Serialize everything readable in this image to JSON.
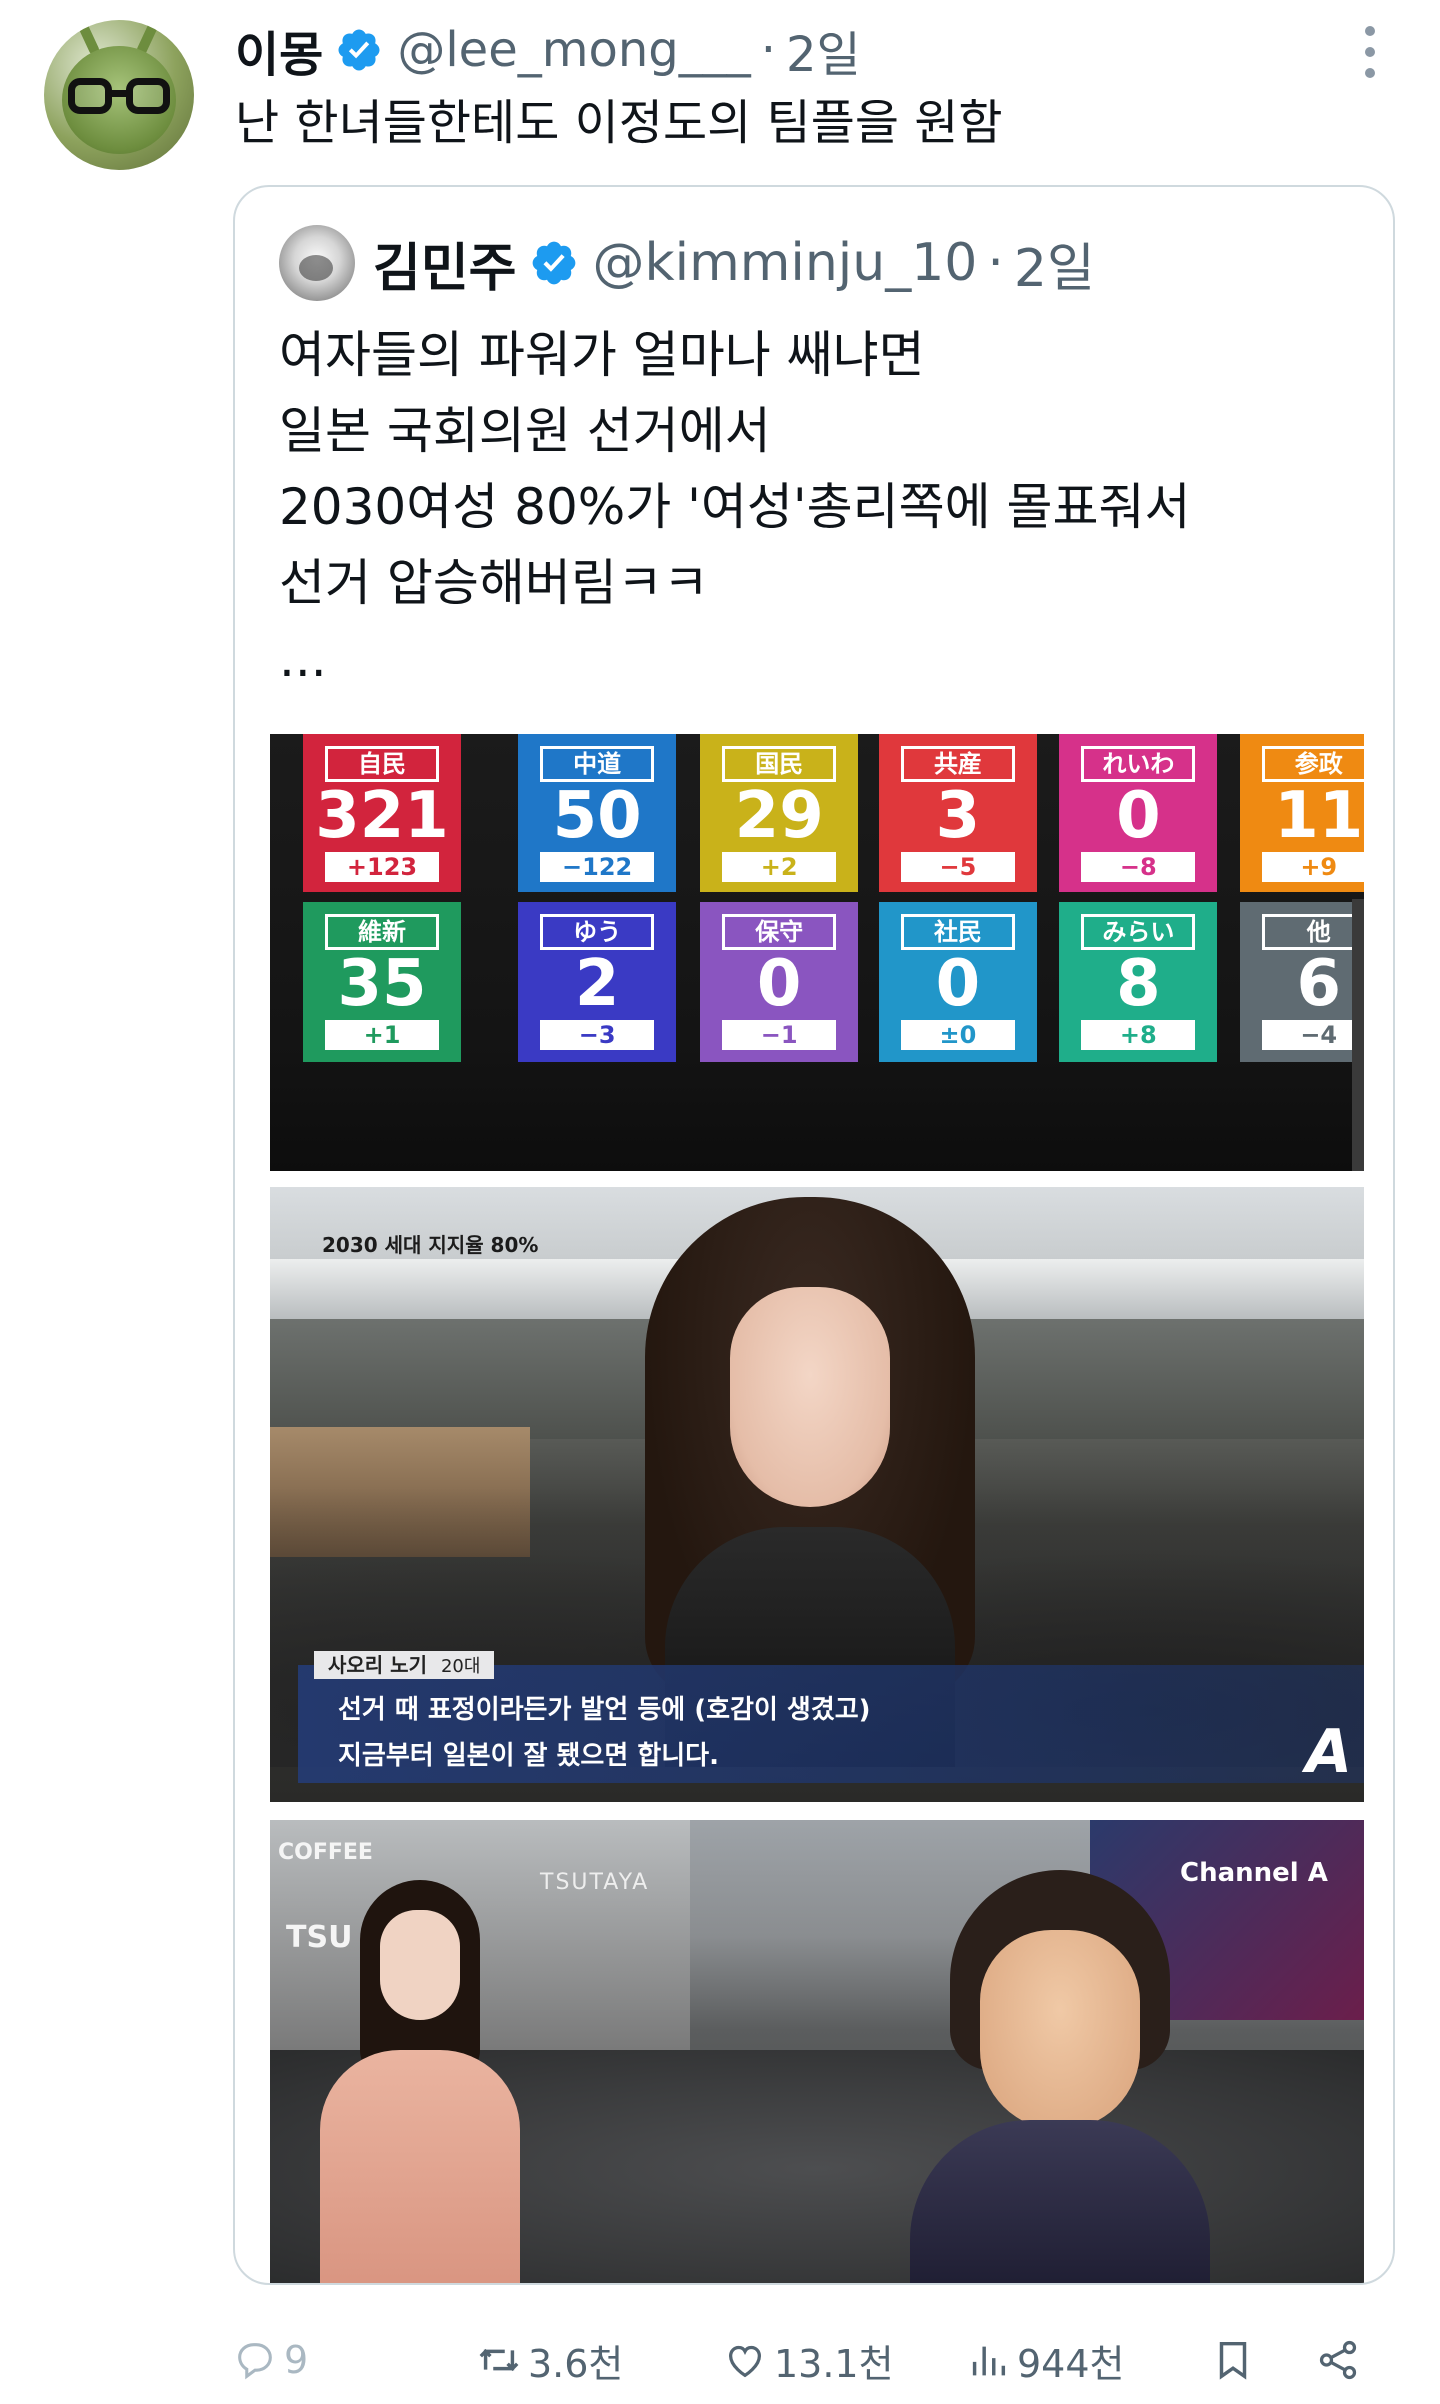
{
  "tweet": {
    "display_name": "이몽",
    "handle": "@lee_mong___",
    "separator": "·",
    "time": "2일",
    "text": "난 한녀들한테도 이정도의 팀플을 원함"
  },
  "quoted": {
    "display_name": "김민주",
    "handle": "@kimminju_10",
    "separator": "·",
    "time": "2일",
    "lines": [
      "여자들의 파워가 얼마나 쌔냐면",
      "일본 국회의원 선거에서",
      "2030여성 80%가 '여성'총리쪽에 몰표줘서",
      "선거 압승해버림ㅋㅋ",
      "..."
    ]
  },
  "results": [
    {
      "party": "自民",
      "seats": "321",
      "delta": "+123",
      "color": "#d2243d"
    },
    {
      "party": "中道",
      "seats": "50",
      "delta": "−122",
      "color": "#1f77c8"
    },
    {
      "party": "国民",
      "seats": "29",
      "delta": "+2",
      "color": "#c9b21a"
    },
    {
      "party": "共産",
      "seats": "3",
      "delta": "−5",
      "color": "#e0383c"
    },
    {
      "party": "れいわ",
      "seats": "0",
      "delta": "−8",
      "color": "#d6318a"
    },
    {
      "party": "参政",
      "seats": "11",
      "delta": "+9",
      "color": "#ef8a12"
    },
    {
      "party": "維新",
      "seats": "35",
      "delta": "+1",
      "color": "#1f9a5e"
    },
    {
      "party": "ゆう",
      "seats": "2",
      "delta": "−3",
      "color": "#3a3ac4"
    },
    {
      "party": "保守",
      "seats": "0",
      "delta": "−1",
      "color": "#8a55c0"
    },
    {
      "party": "社民",
      "seats": "0",
      "delta": "±0",
      "color": "#2196c9"
    },
    {
      "party": "みらい",
      "seats": "8",
      "delta": "+8",
      "color": "#1fae8a"
    },
    {
      "party": "他",
      "seats": "6",
      "delta": "−4",
      "color": "#5f6b72"
    }
  ],
  "interview": {
    "corner_caption": "2030 세대 지지율 80%",
    "speaker": "사오리 노기",
    "speaker_age": "20대",
    "line1": "선거 때 표정이라든가 발언 등에 (호감이 생겼고)",
    "line2": "지금부터 일본이 잘 됐으면 합니다.",
    "logo": "A"
  },
  "street": {
    "sign_coffee": "COFFEE",
    "sign_tsu": "TSU",
    "sign_tsutaya": "TSUTAYA",
    "channel": "Channel A"
  },
  "actions": {
    "replies": "9",
    "retweets": "3.6천",
    "likes": "13.1천",
    "views": "944천"
  },
  "colors": {
    "verified": "#1d9bf0",
    "muted_text": "#536471",
    "border": "#cfd9de"
  }
}
